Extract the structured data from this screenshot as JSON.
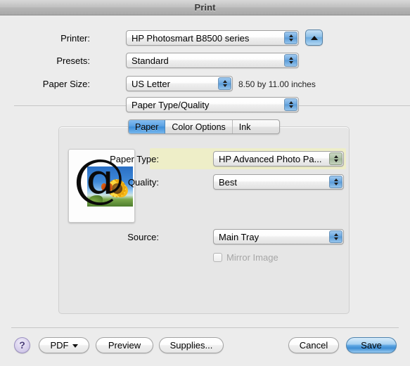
{
  "window": {
    "title": "Print"
  },
  "form": {
    "printer_label": "Printer:",
    "printer_value": "HP Photosmart B8500 series",
    "expand_button_icon": "triangle-up-icon",
    "presets_label": "Presets:",
    "presets_value": "Standard",
    "paper_size_label": "Paper Size:",
    "paper_size_value": "US Letter",
    "paper_size_note": "8.50 by 11.00 inches",
    "pane_value": "Paper Type/Quality"
  },
  "tabs": [
    {
      "label": "Paper",
      "active": true
    },
    {
      "label": "Color Options",
      "active": false
    },
    {
      "label": "Ink",
      "active": false
    }
  ],
  "paper_pane": {
    "paper_type_label": "Paper Type:",
    "paper_type_value": "HP Advanced Photo Pa...",
    "quality_label": "Quality:",
    "quality_value": "Best",
    "source_label": "Source:",
    "source_value": "Main Tray",
    "mirror_image_label": "Mirror Image",
    "mirror_image_checked": false,
    "mirror_image_enabled": false,
    "preview_alt": "sunflower-with-at-symbol"
  },
  "footer": {
    "help_label": "?",
    "pdf_label": "PDF",
    "preview_label": "Preview",
    "supplies_label": "Supplies...",
    "cancel_label": "Cancel",
    "save_label": "Save"
  },
  "colors": {
    "window_bg": "#ececec",
    "highlight_band": "#eeeec8",
    "accent_blue": "#3f90da",
    "help_purple": "#c5bbe2"
  }
}
